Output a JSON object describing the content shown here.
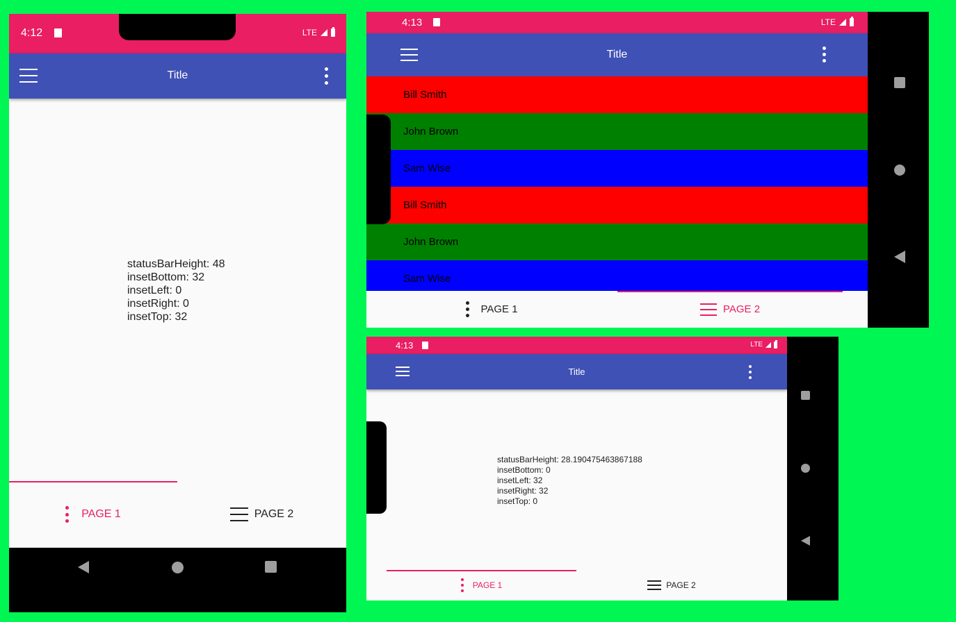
{
  "colors": {
    "background": "#00f653",
    "status_bar": "#e91e63",
    "app_bar": "#3f51b5",
    "accent": "#e91e63",
    "nav_bar": "#000000"
  },
  "icons": [
    "sd-card-icon",
    "signal-icon",
    "battery-icon",
    "hamburger-menu-icon",
    "more-vert-icon",
    "back-icon",
    "home-icon",
    "recents-icon"
  ],
  "portrait": {
    "status_time": "4:12",
    "network": "LTE",
    "title": "Title",
    "info": [
      "statusBarHeight: 48",
      "insetBottom: 32",
      "insetLeft: 0",
      "insetRight: 0",
      "insetTop: 32"
    ],
    "tabs": [
      {
        "label": "PAGE 1",
        "icon": "more-vert-icon",
        "selected": true
      },
      {
        "label": "PAGE 2",
        "icon": "hamburger-menu-icon",
        "selected": false
      }
    ]
  },
  "landscape_list": {
    "status_time": "4:13",
    "network": "LTE",
    "title": "Title",
    "rows": [
      {
        "name": "Bill Smith",
        "color": "#ff0000"
      },
      {
        "name": "John Brown",
        "color": "#008000"
      },
      {
        "name": "Sam Wise",
        "color": "#0000ff"
      },
      {
        "name": "Bill Smith",
        "color": "#ff0000"
      },
      {
        "name": "John Brown",
        "color": "#008000"
      },
      {
        "name": "Sam Wise",
        "color": "#0000ff"
      }
    ],
    "tabs": [
      {
        "label": "PAGE 1",
        "icon": "more-vert-icon",
        "selected": false
      },
      {
        "label": "PAGE 2",
        "icon": "hamburger-menu-icon",
        "selected": true
      }
    ]
  },
  "landscape_info": {
    "status_time": "4:13",
    "network": "LTE",
    "title": "Title",
    "info": [
      "statusBarHeight: 28.190475463867188",
      "insetBottom: 0",
      "insetLeft: 32",
      "insetRight: 32",
      "insetTop: 0"
    ],
    "tabs": [
      {
        "label": "PAGE 1",
        "icon": "more-vert-icon",
        "selected": true
      },
      {
        "label": "PAGE 2",
        "icon": "hamburger-menu-icon",
        "selected": false
      }
    ]
  }
}
